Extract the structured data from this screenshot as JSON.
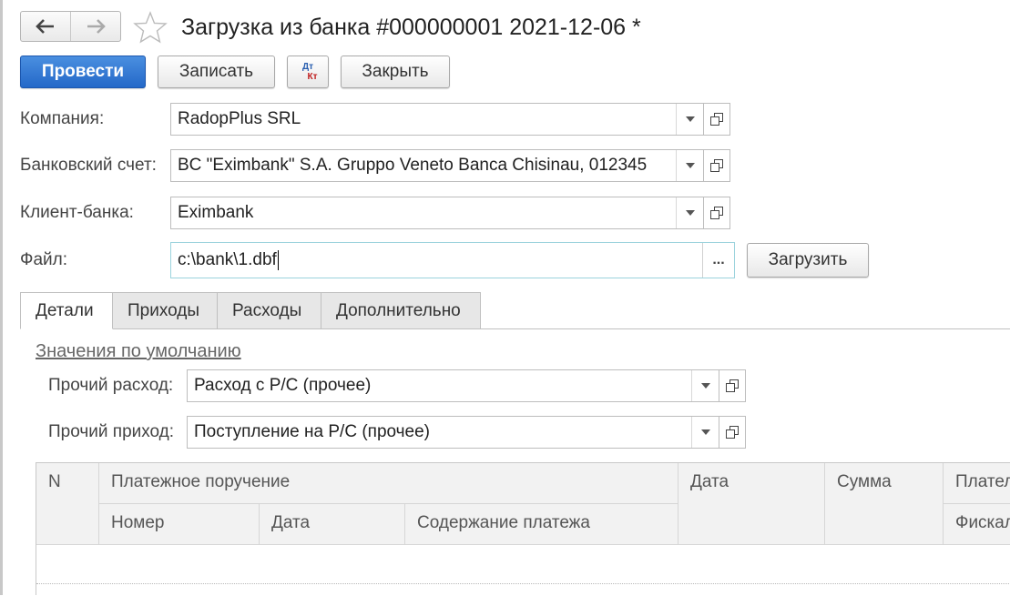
{
  "window": {
    "title": "Загрузка из банка #000000001 2021-12-06 *"
  },
  "toolbar": {
    "post_label": "Провести",
    "save_label": "Записать",
    "dtkt_top": "Дт",
    "dtkt_bottom": "Кт",
    "close_label": "Закрыть"
  },
  "form": {
    "company": {
      "label": "Компания:",
      "value": "RadopPlus SRL"
    },
    "bank_account": {
      "label": "Банковский счет:",
      "value": "BC \"Eximbank\" S.A. Gruppo Veneto Banca Chisinau, 012345"
    },
    "bank_client": {
      "label": "Клиент-банка:",
      "value": "Eximbank"
    },
    "file": {
      "label": "Файл:",
      "value": "c:\\bank\\1.dbf",
      "browse": "...",
      "load_label": "Загрузить"
    }
  },
  "tabs": [
    "Детали",
    "Приходы",
    "Расходы",
    "Дополнительно"
  ],
  "defaults": {
    "title": "Значения по умолчанию",
    "other_expense": {
      "label": "Прочий расход:",
      "value": "Расход с Р/С  (прочее)"
    },
    "other_income": {
      "label": "Прочий приход:",
      "value": "Поступление на Р/С (прочее)"
    }
  },
  "table": {
    "headers": {
      "n": "N",
      "payment_order": "Платежное поручение",
      "number": "Номер",
      "po_date": "Дата",
      "content": "Содержание платежа",
      "date": "Дата",
      "sum": "Сумма",
      "payer": "Плател",
      "fiscal": "Фискал"
    }
  },
  "colors": {
    "primary": "#2468c8",
    "file_border": "#9cd3dd"
  }
}
